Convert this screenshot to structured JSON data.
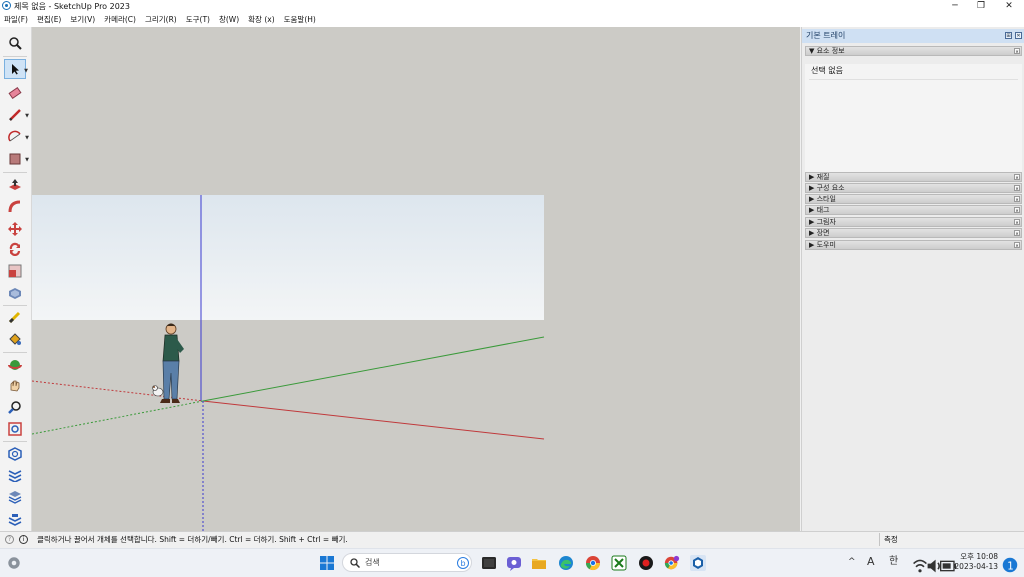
{
  "window": {
    "title": "제목 없음 - SketchUp Pro 2023",
    "minimize_glyph": "─",
    "maximize_glyph": "❐",
    "close_glyph": "✕"
  },
  "menu": [
    "파일(F)",
    "편집(E)",
    "보기(V)",
    "카메라(C)",
    "그리기(R)",
    "도구(T)",
    "창(W)",
    "확장 (x)",
    "도움말(H)"
  ],
  "tools": [
    {
      "icon": "search-icon",
      "name": "zoom-window"
    },
    {
      "icon": "select-arrow-icon",
      "name": "select",
      "selected": true
    },
    {
      "icon": "eraser-icon",
      "name": "eraser"
    },
    {
      "icon": "pencil-icon",
      "name": "line"
    },
    {
      "icon": "arc-icon",
      "name": "arc"
    },
    {
      "icon": "rectangle-icon",
      "name": "rectangle"
    },
    {
      "icon": "push-pull-icon",
      "name": "push-pull"
    },
    {
      "icon": "follow-me-icon",
      "name": "follow-me"
    },
    {
      "icon": "move-icon",
      "name": "move"
    },
    {
      "icon": "rotate-icon",
      "name": "rotate"
    },
    {
      "icon": "scale-icon",
      "name": "scale"
    },
    {
      "icon": "offset-icon",
      "name": "offset"
    },
    {
      "icon": "tape-measure-icon",
      "name": "tape-measure"
    },
    {
      "icon": "paint-bucket-icon",
      "name": "paint-bucket"
    },
    {
      "icon": "orbit-icon",
      "name": "orbit"
    },
    {
      "icon": "pan-icon",
      "name": "pan"
    },
    {
      "icon": "zoom-icon",
      "name": "zoom"
    },
    {
      "icon": "zoom-extents-icon",
      "name": "zoom-extents"
    },
    {
      "icon": "warehouse-icon",
      "name": "3d-warehouse"
    },
    {
      "icon": "extension-warehouse-icon",
      "name": "extension-warehouse"
    },
    {
      "icon": "layout-icon",
      "name": "send-to-layout"
    },
    {
      "icon": "extension-manager-icon",
      "name": "extension-manager"
    }
  ],
  "colors": {
    "axis_red": "#c0393b",
    "axis_green": "#3a9a3a",
    "axis_blue": "#3a3ad0",
    "viewport_bg": "#cccbc6",
    "tray_header": "#cfe0f3"
  },
  "tray": {
    "title": "기본 트레이",
    "entity_info": {
      "label": "요소 정보",
      "content": "선택 없음"
    },
    "panels": [
      "재질",
      "구성 요소",
      "스타일",
      "태그",
      "그림자",
      "장면",
      "도우미"
    ]
  },
  "status": {
    "message": "클릭하거나 끌어서 개체를 선택합니다. Shift = 더하기/빼기. Ctrl = 더하기. Shift + Ctrl = 빼기.",
    "measurement_label": "측정"
  },
  "taskbar": {
    "search_placeholder": "검색",
    "apps": [
      "windows-start-icon",
      "search-icon",
      "bing-icon",
      "terminal-icon",
      "teams-icon",
      "file-explorer-icon",
      "edge-icon",
      "chrome-icon",
      "xbox-icon",
      "record-icon",
      "chrome-profile-icon",
      "sketchup-icon"
    ],
    "chevron": "^",
    "ime_letter": "A",
    "ime_lang": "한",
    "time": "오후 10:08",
    "date": "2023-04-13"
  }
}
